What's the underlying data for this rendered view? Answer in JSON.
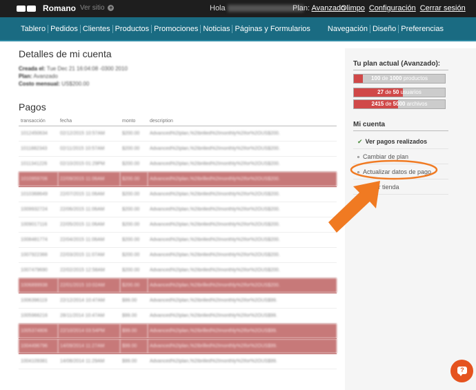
{
  "topbar": {
    "brand": "Romano",
    "visit_label": "Ver sitio",
    "hello": "Hola",
    "plan_label": "Plan:",
    "plan_name": "Avanzado",
    "links": [
      "Olimpo",
      "Configuración",
      "Cerrar sesión"
    ]
  },
  "nav": {
    "left": [
      "Tablero",
      "Pedidos",
      "Clientes",
      "Productos",
      "Promociones",
      "Noticias",
      "Páginas y Formularios"
    ],
    "right": [
      "Navegación",
      "Diseño",
      "Preferencias"
    ]
  },
  "account": {
    "title": "Detalles de mi cuenta",
    "created_label": "Creada el:",
    "created_value": "Tue Dec 21 16:04:08 -0300 2010",
    "plan_label": "Plan:",
    "plan_value": "Avanzado",
    "cost_label": "Costo mensual:",
    "cost_value": "US$200.00"
  },
  "payments": {
    "title": "Pagos",
    "headers": [
      "transacción",
      "fecha",
      "monto",
      "description"
    ],
    "rows": [
      {
        "id": "1012450634",
        "date": "02/12/2015 10:57AM",
        "amount": "$200.00",
        "desc": "Advanced%2Iplan,%2Ibrilled%2Imonthly%2Ifor%2OUS$200.",
        "hl": false
      },
      {
        "id": "1011882343",
        "date": "02/11/2015 10:57AM",
        "amount": "$200.00",
        "desc": "Advanced%2Iplan,%2Ibrilled%2Imonthly%2Ifor%2OUS$200.",
        "hl": false
      },
      {
        "id": "1011341226",
        "date": "02/10/2015 01:29PM",
        "amount": "$200.00",
        "desc": "Advanced%2Iplan,%2Ibrilled%2Imonthly%2Ifor%2OUS$200.",
        "hl": false
      },
      {
        "id": "1010959706",
        "date": "22/09/2015 11:06AM",
        "amount": "$200.00",
        "desc": "Advanced%2Iplan,%2Ibrilled%2Imonthly%2Ifor%2OUS$200.",
        "hl": true
      },
      {
        "id": "1010368649",
        "date": "22/07/2015 11:06AM",
        "amount": "$200.00",
        "desc": "Advanced%2Iplan,%2Ibrilled%2Imonthly%2Ifor%2OUS$200.",
        "hl": false
      },
      {
        "id": "1009932724",
        "date": "22/06/2015 11:06AM",
        "amount": "$200.00",
        "desc": "Advanced%2Iplan,%2Ibrilled%2Imonthly%2Ifor%2OUS$200.",
        "hl": false
      },
      {
        "id": "1009017116",
        "date": "22/05/2015 11:06AM",
        "amount": "$200.00",
        "desc": "Advanced%2Iplan,%2Ibrilled%2Imonthly%2Ifor%2OUS$200.",
        "hl": false
      },
      {
        "id": "1008481774",
        "date": "22/04/2015 11:06AM",
        "amount": "$200.00",
        "desc": "Advanced%2Iplan,%2Ibrilled%2Imonthly%2Ifor%2OUS$200.",
        "hl": false
      },
      {
        "id": "1007922366",
        "date": "22/03/2015 11:07AM",
        "amount": "$200.00",
        "desc": "Advanced%2Iplan,%2Ibrilled%2Imonthly%2Ifor%2OUS$200.",
        "hl": false
      },
      {
        "id": "1007479690",
        "date": "22/02/2015 12:58AM",
        "amount": "$200.00",
        "desc": "Advanced%2Iplan,%2Ibrilled%2Imonthly%2Ifor%2OUS$200.",
        "hl": false
      },
      {
        "id": "1006899938",
        "date": "22/01/2015 10:02AM",
        "amount": "$200.00",
        "desc": "Advanced%2Iplan,%2Ibrilled%2Imonthly%2Ifor%2OUS$200.",
        "hl": true
      },
      {
        "id": "1006396119",
        "date": "22/12/2014 10:47AM",
        "amount": "$99.00",
        "desc": "Advanced%2Iplan,%2Ibrilled%2Imonthly%2Ifor%2OUS$99.",
        "hl": false
      },
      {
        "id": "1005966216",
        "date": "28/11/2014 10:47AM",
        "amount": "$99.00",
        "desc": "Advanced%2Iplan,%2Ibrilled%2Imonthly%2Ifor%2OUS$99.",
        "hl": false
      },
      {
        "id": "1005374806",
        "date": "22/10/2014 03:54PM",
        "amount": "$99.00",
        "desc": "Advanced%2Iplan,%2Ibrilled%2Imonthly%2Ifor%2OUS$99.",
        "hl": true
      },
      {
        "id": "1004496796",
        "date": "14/09/2014 11:27AM",
        "amount": "$99.00",
        "desc": "Advanced%2Iplan,%2Ibrilled%2Imonthly%2Ifor%2OUS$99.",
        "hl": true
      },
      {
        "id": "1004109381",
        "date": "14/08/2014 11:29AM",
        "amount": "$99.00",
        "desc": "Advanced%2Iplan,%2Ibrilled%2Imonthly%2Ifor%2OUS$99.",
        "hl": false
      }
    ]
  },
  "sidebar": {
    "plan_title": "Tu plan actual (Avanzado):",
    "quotas": [
      {
        "used": "100",
        "of": "de",
        "total": "1000",
        "unit": "productos",
        "fraction": 0.1
      },
      {
        "used": "27",
        "of": "de",
        "total": "50",
        "unit": "usuarios",
        "fraction": 0.54
      },
      {
        "used": "2415",
        "of": "de",
        "total": "5000",
        "unit": "archivos",
        "fraction": 0.483
      }
    ],
    "account_title": "Mi cuenta",
    "menu": [
      {
        "label": "Ver pagos realizados",
        "active": true
      },
      {
        "label": "Cambiar de plan",
        "active": false
      },
      {
        "label": "Actualizar datos de pago",
        "active": false
      },
      {
        "label": "Cerrar tienda",
        "active": false
      }
    ]
  },
  "colors": {
    "annotation": "#f07a22",
    "highlight_row": "#c77979",
    "nav_bg": "#1a6b82",
    "quota_fill": "#d04848"
  },
  "help": {
    "icon": "chat-bubble-question-icon",
    "glyph": "?"
  }
}
